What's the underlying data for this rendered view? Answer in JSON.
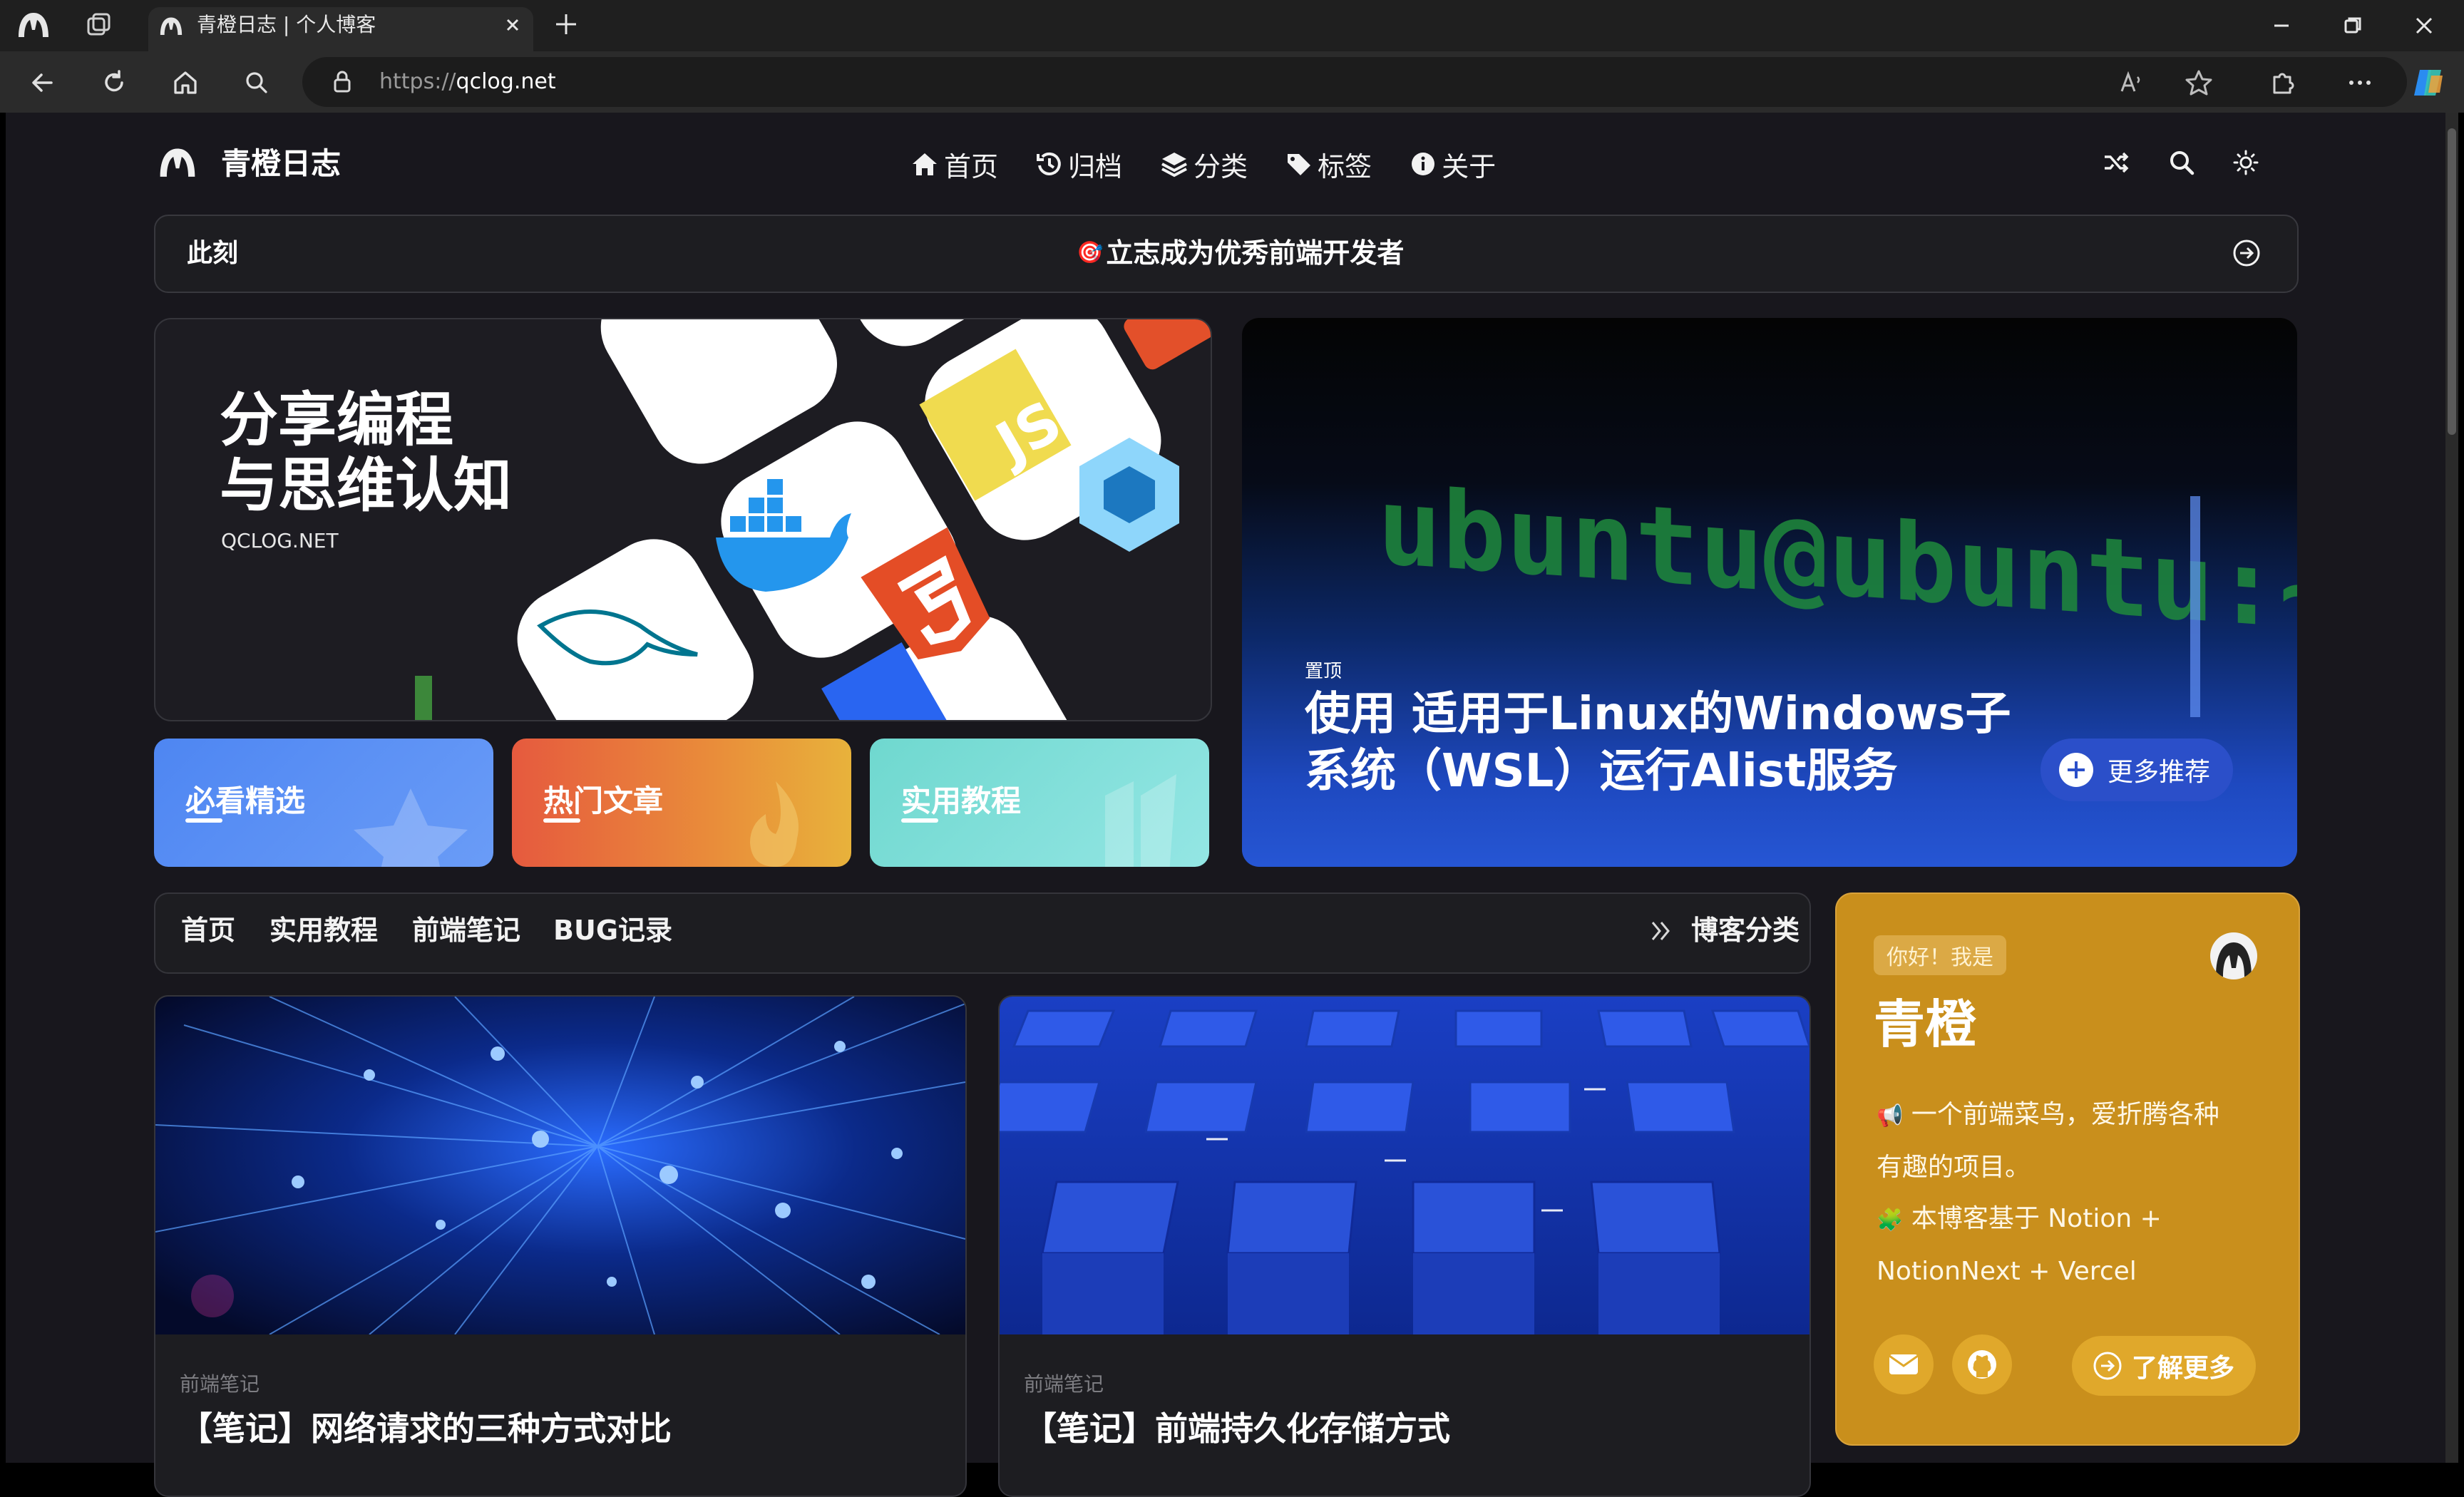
{
  "browser": {
    "tab_title": "青橙日志 | 个人博客",
    "url_protocol": "https://",
    "url_host": "qclog.net"
  },
  "site": {
    "title": "青橙日志",
    "nav": [
      {
        "label": "首页",
        "icon": "home-icon"
      },
      {
        "label": "归档",
        "icon": "history-icon"
      },
      {
        "label": "分类",
        "icon": "layers-icon"
      },
      {
        "label": "标签",
        "icon": "tag-icon"
      },
      {
        "label": "关于",
        "icon": "info-icon"
      }
    ]
  },
  "notice": {
    "label": "此刻",
    "emoji": "🎯",
    "text": "立志成为优秀前端开发者"
  },
  "hero_left": {
    "line1": "分享编程",
    "line2": "与思维认知",
    "sub": "QCLOG.NET"
  },
  "hero_right": {
    "terminal_text": "ubuntu@ubuntu:~$",
    "badge": "置顶",
    "title_line1": "使用 适用于Linux的Windows子",
    "title_line2": "系统（WSL）运行Alist服务",
    "more_button": "更多推荐"
  },
  "category_cards": [
    {
      "label": "必看精选",
      "color": "#5b8ef5"
    },
    {
      "label": "热门文章",
      "color": "#e9713c"
    },
    {
      "label": "实用教程",
      "color": "#7ee0d9"
    }
  ],
  "category_bar": {
    "items": [
      "首页",
      "实用教程",
      "前端笔记",
      "BUG记录"
    ],
    "more": "博客分类"
  },
  "posts": [
    {
      "category": "前端笔记",
      "title": "【笔记】网络请求的三种方式对比"
    },
    {
      "category": "前端笔记",
      "title": "【笔记】前端持久化存储方式"
    }
  ],
  "profile": {
    "greeting": "你好！我是",
    "name": "青橙",
    "line1_emoji": "📢",
    "line1a": "一个前端菜鸟，爱折腾各种",
    "line1b": "有趣的项目。",
    "line2_emoji": "🧩",
    "line2a": "本博客基于 Notion +",
    "line2b": "NotionNext + Vercel",
    "more_button": "了解更多"
  },
  "colors": {
    "page_bg": "#18171d",
    "profile_bg": "#c98f1c",
    "accent_blue": "#2656d4"
  }
}
